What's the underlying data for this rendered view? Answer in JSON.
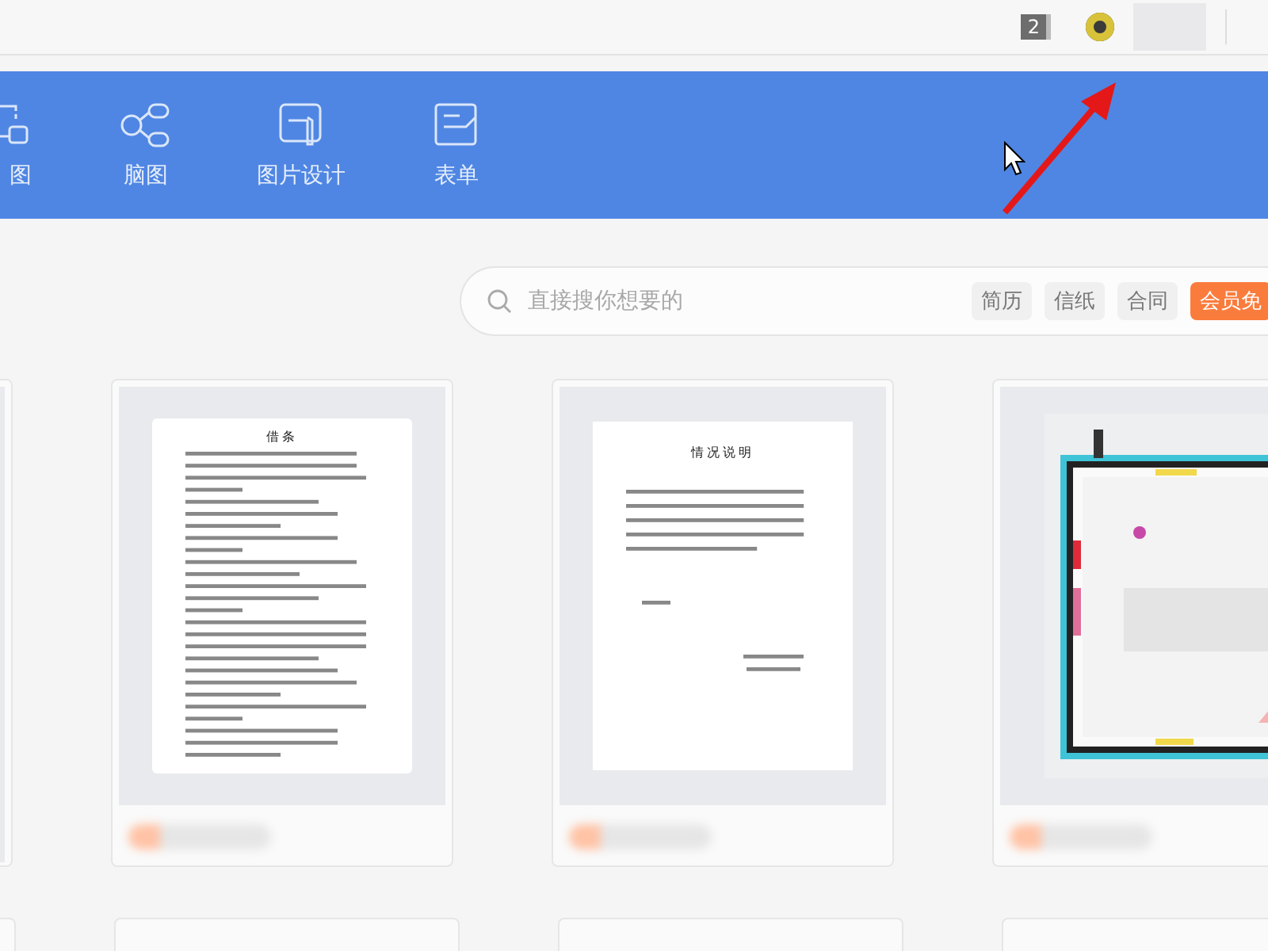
{
  "topbar": {
    "badge": "2"
  },
  "toolbar": {
    "items": [
      {
        "label": "图"
      },
      {
        "label": "脑图"
      },
      {
        "label": "图片设计"
      },
      {
        "label": "表单"
      }
    ]
  },
  "search": {
    "placeholder": "直接搜你想要的",
    "tags": [
      {
        "label": "简历",
        "kind": "plain"
      },
      {
        "label": "信纸",
        "kind": "plain"
      },
      {
        "label": "合同",
        "kind": "plain"
      },
      {
        "label": "会员免",
        "kind": "highlight"
      }
    ]
  },
  "templates": [
    {
      "kind": "partial"
    },
    {
      "kind": "document",
      "title": "借条"
    },
    {
      "kind": "document",
      "title": "情况说明"
    },
    {
      "kind": "picture"
    }
  ]
}
